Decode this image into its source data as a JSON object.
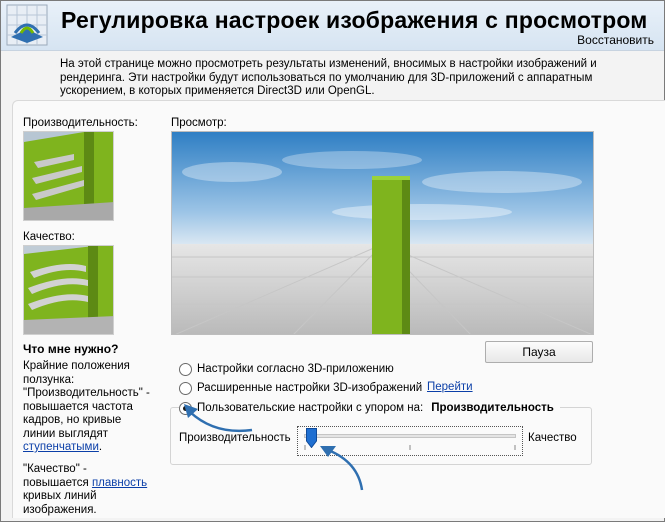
{
  "header": {
    "title": "Регулировка настроек изображения с просмотром",
    "restore_label": "Восстановить"
  },
  "description": "На этой странице можно просмотреть результаты изменений, вносимых в настройки изображений и рендеринга. Эти настройки будут использоваться по умолчанию для 3D-приложений с аппаратным ускорением, в которых применяется Direct3D или OpenGL.",
  "left_panel": {
    "performance_label": "Производительность:",
    "quality_label": "Качество:",
    "help_title": "Что мне нужно?",
    "help_p1_a": "Крайние положения ползунка: \"Производительность\" - повышается частота кадров, но кривые линии выглядят ",
    "help_p1_link": "ступенчатыми",
    "help_p1_b": ".",
    "help_p2_a": "\"Качество\" - повышается ",
    "help_p2_link": "плавность",
    "help_p2_b": " кривых линий изображения."
  },
  "preview": {
    "label": "Просмотр:",
    "pause_label": "Пауза"
  },
  "options": {
    "radio1_label": "Настройки согласно 3D-приложению",
    "radio2_label": "Расширенные настройки 3D-изображений",
    "go_link": "Перейти",
    "radio3_label": "Пользовательские настройки с упором на:",
    "radio3_value": "Производительность",
    "selected": 3
  },
  "slider": {
    "left_label": "Производительность",
    "right_label": "Качество",
    "position": 0
  },
  "colors": {
    "accent_green": "#7fb41e",
    "link_blue": "#0b3fa8",
    "annotation_blue": "#2f6fb0"
  }
}
